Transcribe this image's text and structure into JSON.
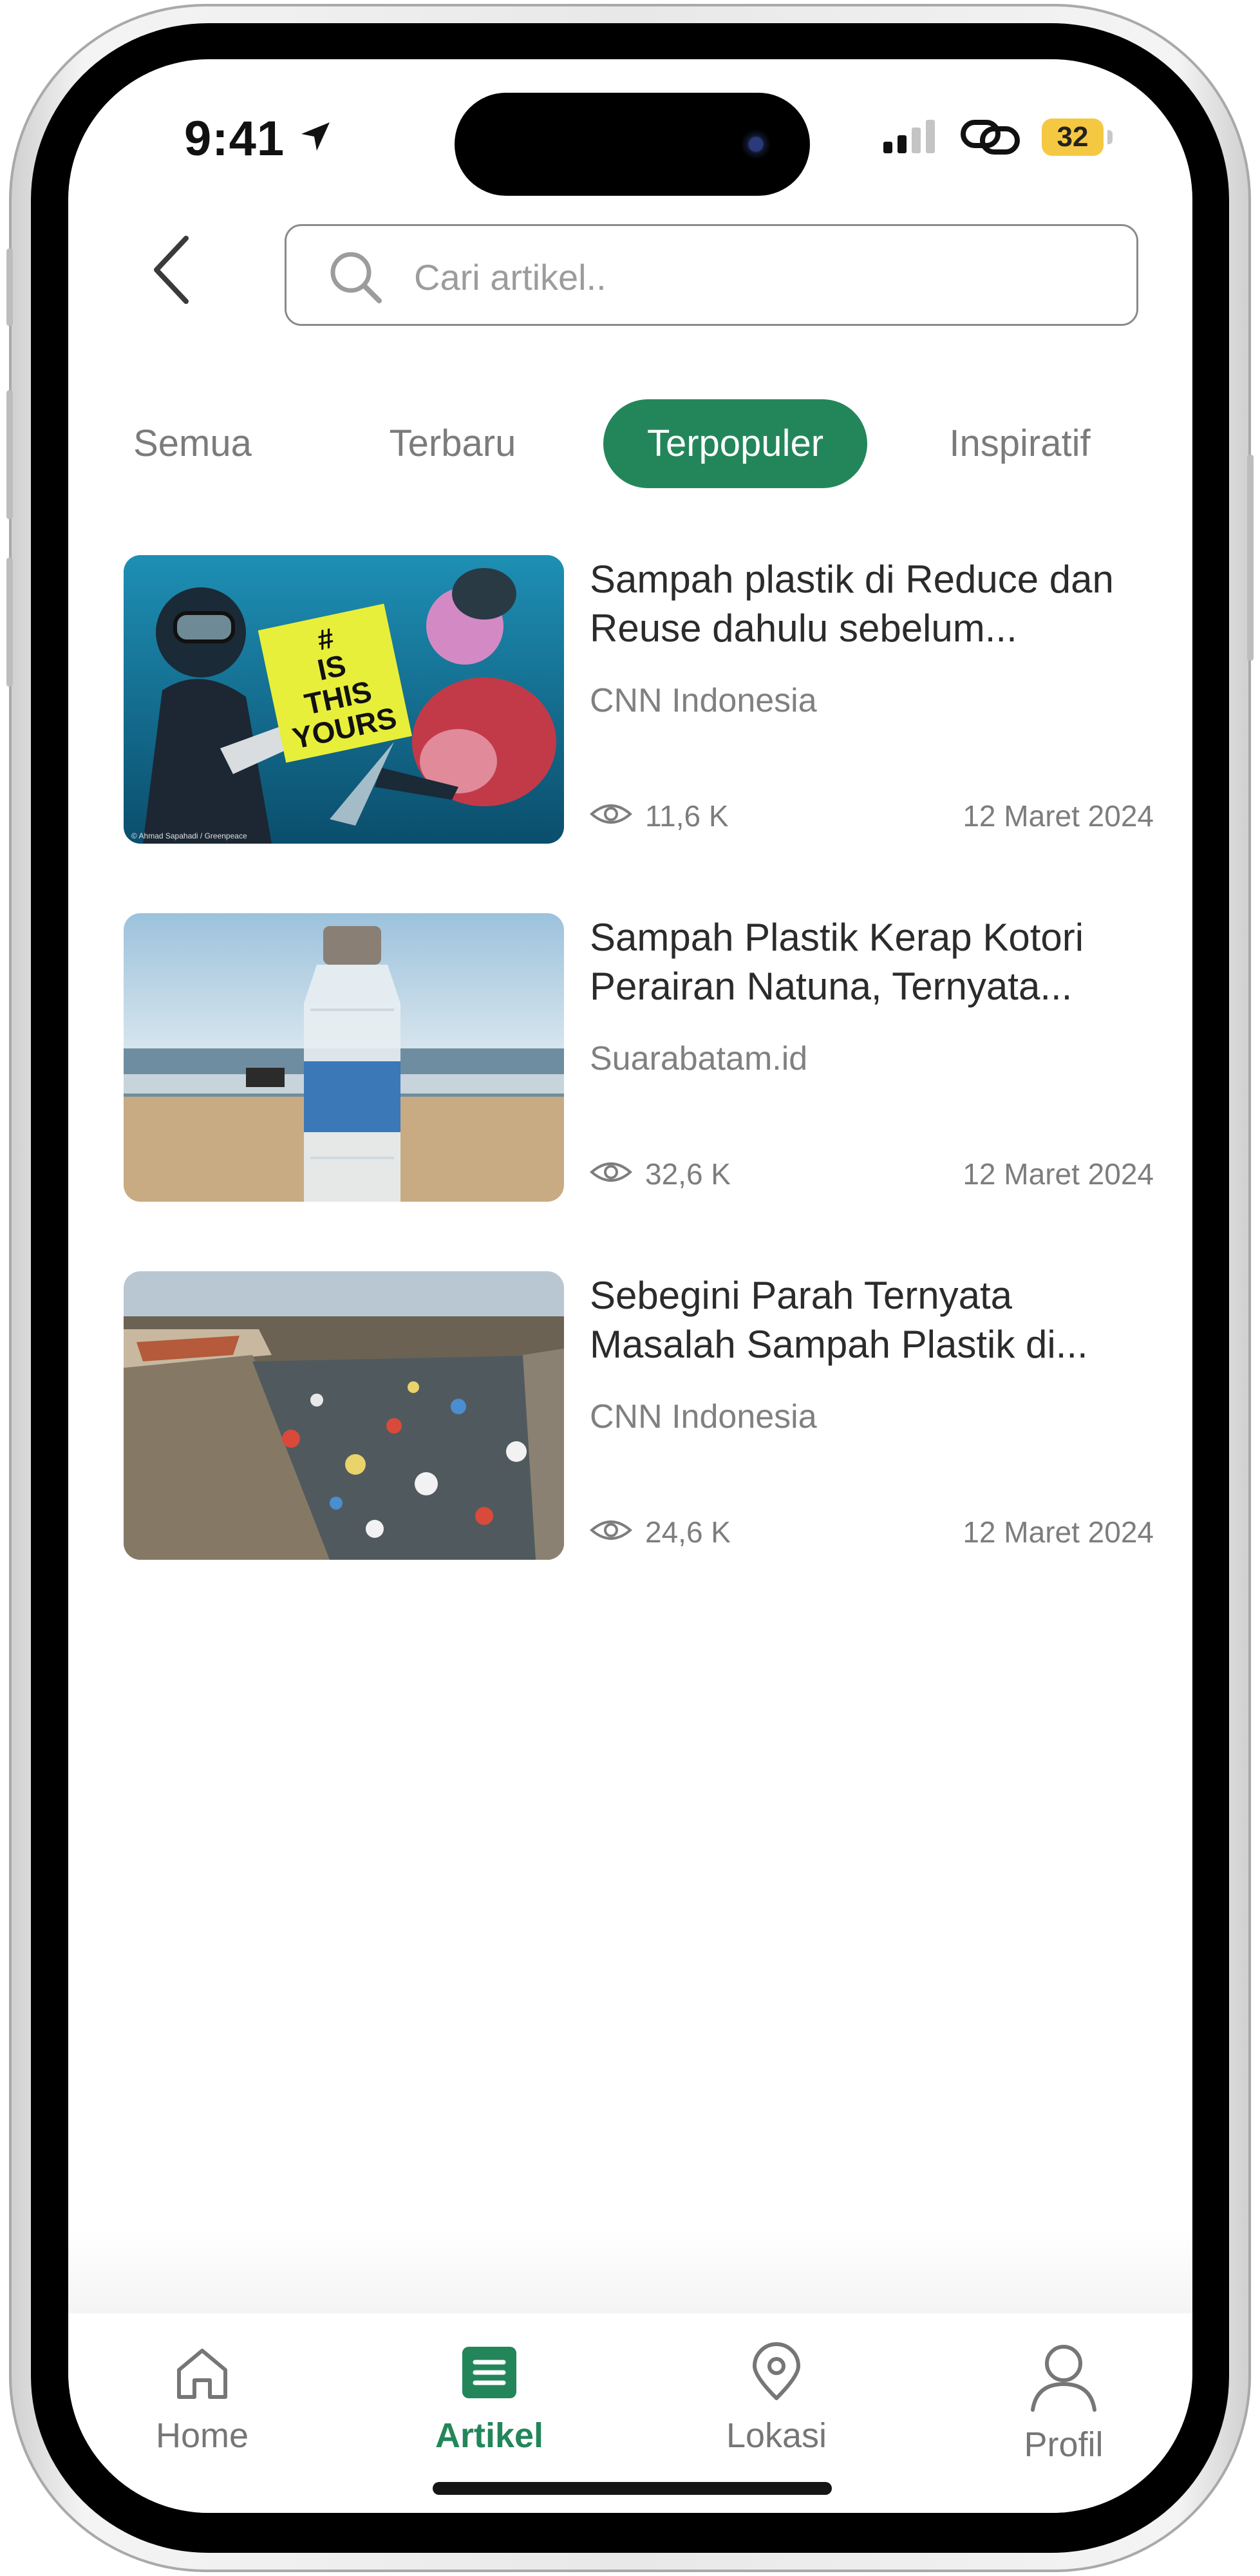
{
  "status_bar": {
    "time": "9:41",
    "battery_level": "32",
    "icons": [
      "location-arrow-icon",
      "signal-icon",
      "link-icon",
      "battery-icon"
    ]
  },
  "header": {
    "back_icon": "chevron-left-icon",
    "search_icon": "search-icon",
    "search_placeholder": "Cari artikel..",
    "search_value": ""
  },
  "tabs": [
    {
      "label": "Semua",
      "active": false
    },
    {
      "label": "Terbaru",
      "active": false
    },
    {
      "label": "Terpopuler",
      "active": true
    },
    {
      "label": "Inspiratif",
      "active": false
    }
  ],
  "articles": [
    {
      "title": "Sampah plastik di Reduce dan Reuse dahulu sebelum...",
      "source": "CNN Indonesia",
      "views": "11,6 K",
      "date": "12 Maret 2024",
      "image_text": "# IS THIS YOURS",
      "image_credit": "© Ahmad Sapahadi / Greenpeace"
    },
    {
      "title": "Sampah Plastik Kerap Kotori Perairan Natuna, Ternyata...",
      "source": "Suarabatam.id",
      "views": "32,6 K",
      "date": "12 Maret 2024"
    },
    {
      "title": "Sebegini Parah Ternyata Masalah Sampah Plastik di...",
      "source": "CNN Indonesia",
      "views": "24,6 K",
      "date": "12 Maret 2024"
    }
  ],
  "bottom_nav": [
    {
      "label": "Home",
      "icon": "home-icon",
      "active": false
    },
    {
      "label": "Artikel",
      "icon": "article-icon",
      "active": true
    },
    {
      "label": "Lokasi",
      "icon": "location-pin-icon",
      "active": false
    },
    {
      "label": "Profil",
      "icon": "profile-icon",
      "active": false
    }
  ],
  "colors": {
    "accent": "#23865b",
    "text": "#2b2b2b",
    "muted": "#7d7d7d",
    "battery": "#f5c842"
  }
}
